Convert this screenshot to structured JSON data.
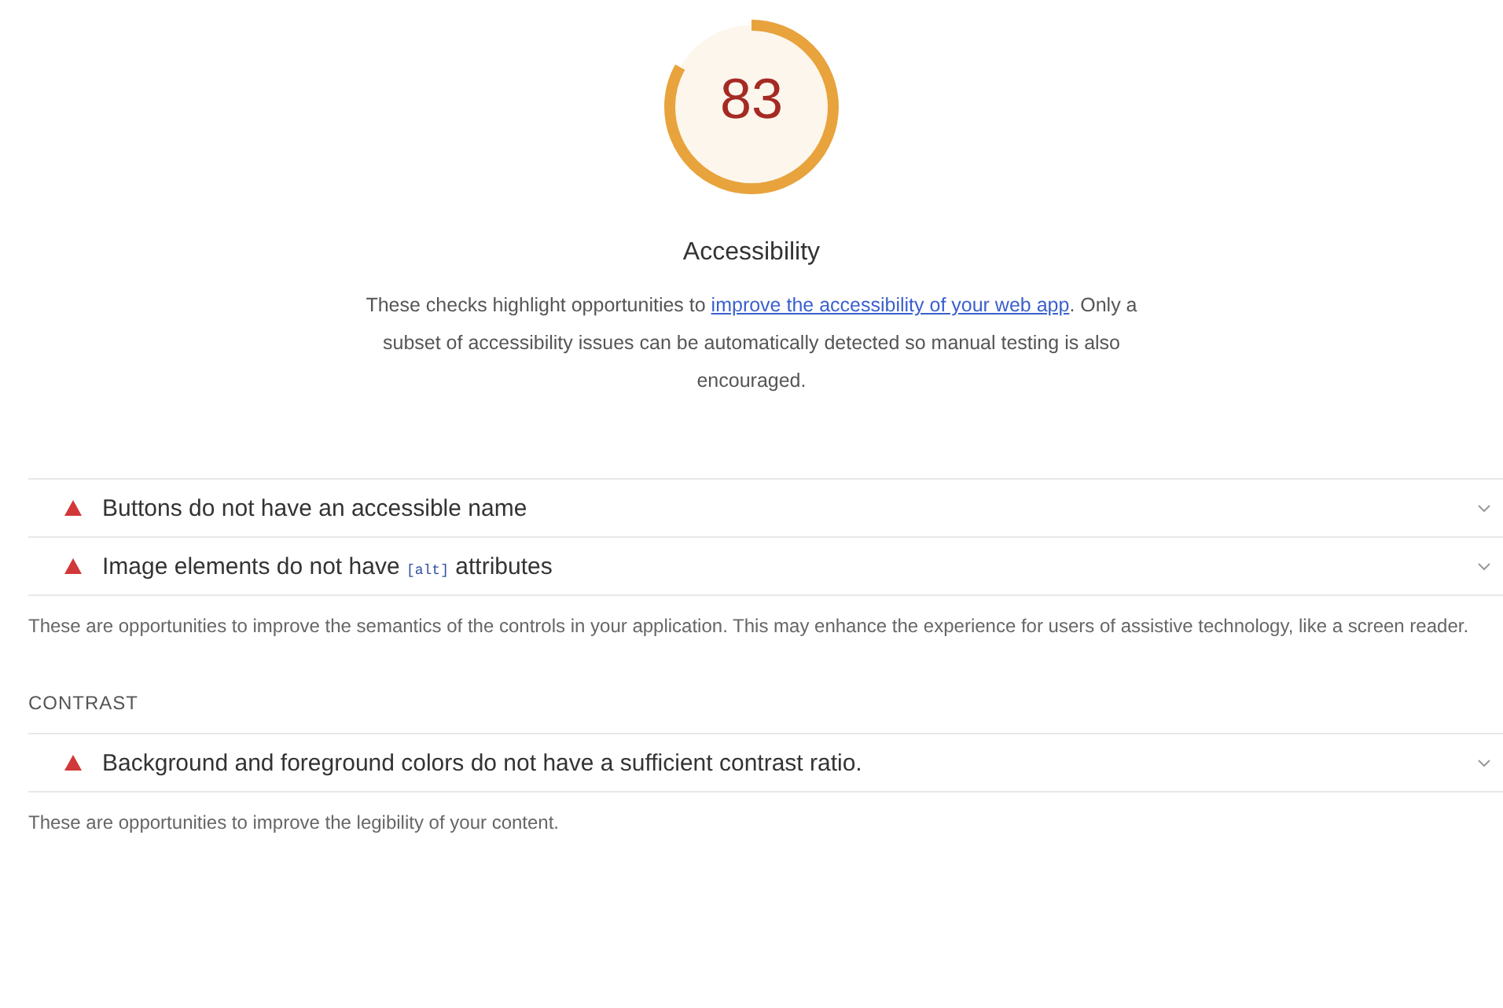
{
  "score": {
    "value": "83",
    "title": "Accessibility"
  },
  "description": {
    "before": "These checks highlight opportunities to ",
    "link": "improve the accessibility of your web app",
    "after": ". Only a subset of accessibility issues can be automatically detected so manual testing is also encouraged."
  },
  "groups": [
    {
      "audits": [
        {
          "parts": [
            {
              "kind": "text",
              "text": "Buttons do not have an accessible name"
            }
          ]
        },
        {
          "parts": [
            {
              "kind": "text",
              "text": "Image elements do not have "
            },
            {
              "kind": "code",
              "text": "[alt]"
            },
            {
              "kind": "text",
              "text": " attributes"
            }
          ]
        }
      ],
      "description": "These are opportunities to improve the semantics of the controls in your application. This may enhance the experience for users of assistive technology, like a screen reader."
    },
    {
      "heading": "CONTRAST",
      "audits": [
        {
          "parts": [
            {
              "kind": "text",
              "text": "Background and foreground colors do not have a sufficient contrast ratio."
            }
          ]
        }
      ],
      "description": "These are opportunities to improve the legibility of your content."
    }
  ]
}
